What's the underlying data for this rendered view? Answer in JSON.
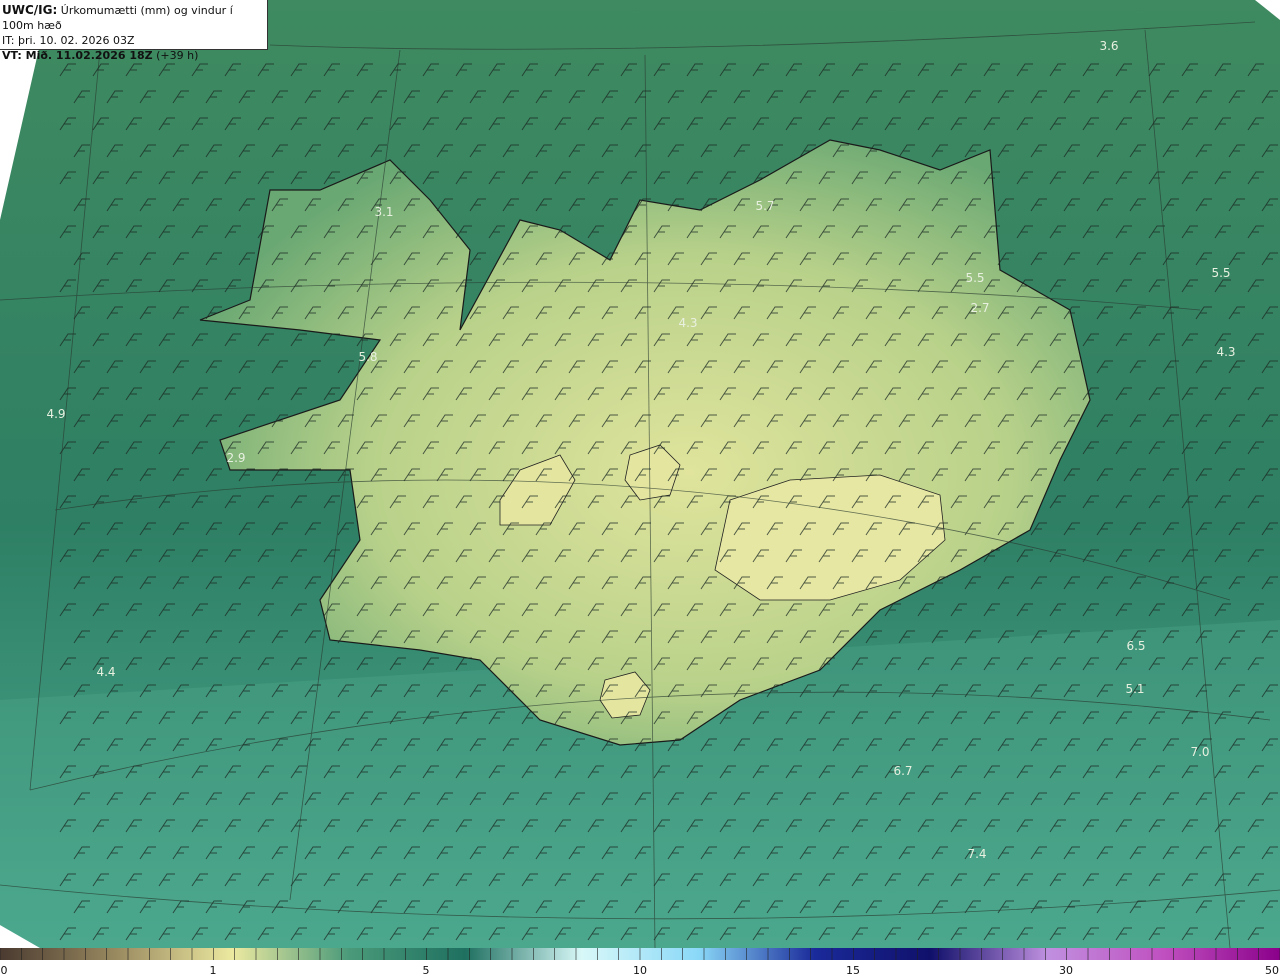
{
  "header": {
    "line1_bold": "UWC/IG:",
    "line1_rest": "Úrkomumætti (mm) og vindur í 100m hæð",
    "line2": "IT: þri. 10. 02. 2026 03Z",
    "line3_bold": "VT: Mið. 11.02.2026 18Z",
    "line3_rest": "(+39 h)"
  },
  "map_values": [
    "3.6",
    "3.1",
    "5.7",
    "5.5",
    "2.7",
    "5.5",
    "4.3",
    "4.3",
    "5.8",
    "4.9",
    "2.9",
    "4.4",
    "6.5",
    "5.1",
    "7.0",
    "6.7",
    "7.4"
  ],
  "colorbar": {
    "ticks": [
      "0",
      "1",
      "5",
      "10",
      "15",
      "30",
      "50"
    ],
    "colors": [
      "#4a3a30",
      "#9a8a60",
      "#ece9a0",
      "#4a9a7a",
      "#1f7060",
      "#d8f8f8",
      "#8ad8f8",
      "#1a2a9a",
      "#10106a",
      "#c090e0",
      "#c050c0",
      "#8a008a"
    ]
  },
  "colors": {
    "sea": "#2f7a62",
    "land": "#c9d98a",
    "coast": "#1a1a1a"
  }
}
